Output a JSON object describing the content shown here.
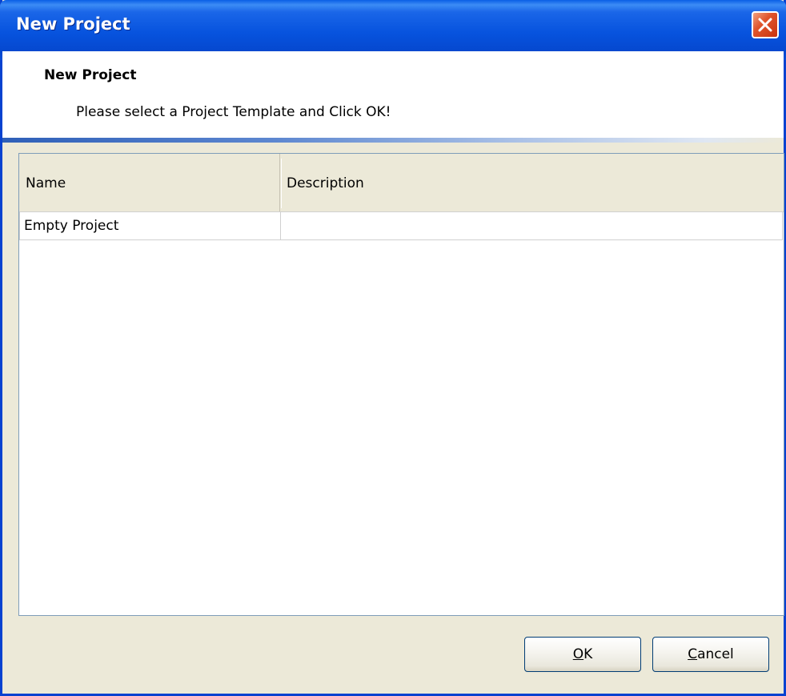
{
  "window": {
    "title": "New Project"
  },
  "header": {
    "title": "New Project",
    "subtitle": "Please select a Project Template and Click OK!"
  },
  "list": {
    "columns": [
      "Name",
      "Description"
    ],
    "rows": [
      {
        "name": "Empty Project",
        "description": ""
      }
    ]
  },
  "buttons": {
    "ok": {
      "accel": "O",
      "rest": "K"
    },
    "cancel": {
      "accel": "C",
      "rest": "ancel"
    }
  },
  "icons": {
    "close": "close-icon"
  },
  "colors": {
    "titlebar": "#0753de",
    "close_button": "#e0552c",
    "dialog_bg": "#ece9d8",
    "list_border": "#7f9db9"
  }
}
